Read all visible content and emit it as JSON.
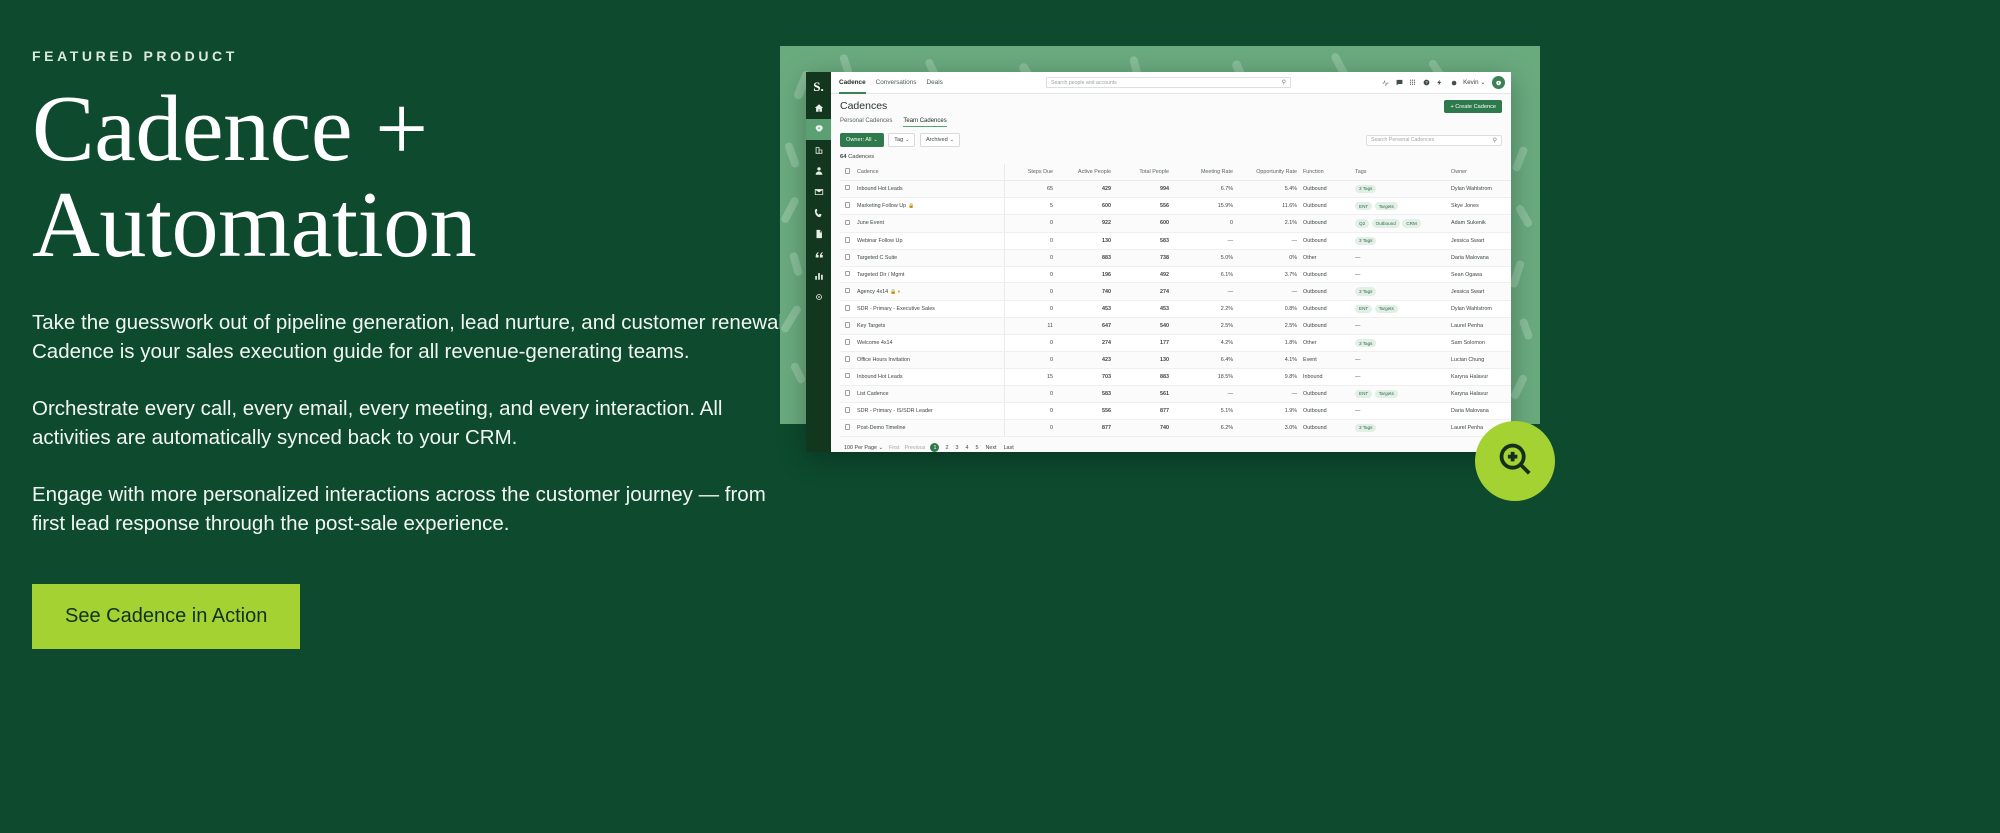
{
  "hero": {
    "eyebrow": "FEATURED PRODUCT",
    "headline": "Cadence +\nAutomation",
    "paragraphs": [
      "Take the guesswork out of pipeline generation, lead nurture, and customer renewals. Cadence is your sales execution guide for all revenue-generating teams.",
      "Orchestrate every call, every email, every meeting, and every interaction. All activities are automatically synced back to your CRM.",
      "Engage with more personalized interactions across the customer journey — from first lead response through the post-sale experience."
    ],
    "cta_label": "See Cadence in Action",
    "colors": {
      "background": "#0d4a2e",
      "cta": "#a4d233",
      "cta_text": "#10321e"
    }
  },
  "screenshot": {
    "rail": {
      "logo": "S.",
      "items": [
        {
          "name": "home-icon",
          "label": "Home"
        },
        {
          "name": "rocket-icon",
          "label": "Cadence"
        },
        {
          "name": "building-icon",
          "label": "Accounts"
        },
        {
          "name": "person-icon",
          "label": "People"
        },
        {
          "name": "envelope-icon",
          "label": "Email"
        },
        {
          "name": "phone-icon",
          "label": "Calls"
        },
        {
          "name": "document-icon",
          "label": "Templates"
        },
        {
          "name": "quote-icon",
          "label": "Snippets"
        },
        {
          "name": "bar-chart-icon",
          "label": "Reports"
        },
        {
          "name": "target-icon",
          "label": "Targets"
        }
      ]
    },
    "topnav": {
      "tabs": [
        {
          "label": "Cadence",
          "selected": true
        },
        {
          "label": "Conversations",
          "selected": false
        },
        {
          "label": "Deals",
          "selected": false
        }
      ],
      "search_placeholder": "Search people and accounts",
      "icons": [
        "activity-icon",
        "chat-icon",
        "dialer-icon",
        "help-icon",
        "lightning-icon",
        "settings-icon"
      ],
      "user_label": "Kevin",
      "avatar_icon": "rocket-icon"
    },
    "page": {
      "title": "Cadences",
      "create_button": "+ Create Cadence",
      "subtabs": [
        {
          "label": "Personal Cadences",
          "selected": false
        },
        {
          "label": "Team Cadences",
          "selected": true
        }
      ],
      "filters": [
        {
          "label": "Owner: All",
          "primary": true
        },
        {
          "label": "Tag",
          "primary": false
        },
        {
          "label": "Archived",
          "primary": false
        }
      ],
      "list_search_placeholder": "Search Personal Cadences",
      "count": "64",
      "count_suffix": " Cadences"
    },
    "table": {
      "columns": [
        "Cadence",
        "Steps Due",
        "Active People",
        "Total People",
        "Meeting Rate",
        "Opportunity Rate",
        "Function",
        "Tags",
        "Owner"
      ],
      "rows": [
        {
          "cadence": "Inbound Hot Leads",
          "lock": false,
          "warn": false,
          "steps_due": "65",
          "active_people": "429",
          "total_people": "994",
          "meeting_rate": "6.7%",
          "opportunity_rate": "5.4%",
          "function": "Outbound",
          "tags": [
            "3 Tags"
          ],
          "owner": "Dylan Wahlstrom"
        },
        {
          "cadence": "Marketing Follow Up",
          "lock": true,
          "warn": false,
          "steps_due": "5",
          "active_people": "600",
          "total_people": "556",
          "meeting_rate": "15.9%",
          "opportunity_rate": "11.6%",
          "function": "Outbound",
          "tags": [
            "ENT",
            "Targets"
          ],
          "owner": "Skye Jones"
        },
        {
          "cadence": "June Event",
          "lock": false,
          "warn": false,
          "steps_due": "0",
          "active_people": "922",
          "total_people": "600",
          "meeting_rate": "0",
          "opportunity_rate": "2.1%",
          "function": "Outbound",
          "tags": [
            "Q2",
            "Outbound",
            "CRM"
          ],
          "owner": "Adam Sukenik"
        },
        {
          "cadence": "Webinar Follow Up",
          "lock": false,
          "warn": false,
          "steps_due": "0",
          "active_people": "130",
          "total_people": "583",
          "meeting_rate": "—",
          "opportunity_rate": "—",
          "function": "Outbound",
          "tags": [
            "3 Tags"
          ],
          "owner": "Jessica Swart"
        },
        {
          "cadence": "Targeted C Suite",
          "lock": false,
          "warn": false,
          "steps_due": "0",
          "active_people": "883",
          "total_people": "738",
          "meeting_rate": "5.0%",
          "opportunity_rate": "0%",
          "function": "Other",
          "tags": [],
          "owner": "Daria Malovana"
        },
        {
          "cadence": "Targeted Dir / Mgmt",
          "lock": false,
          "warn": false,
          "steps_due": "0",
          "active_people": "196",
          "total_people": "492",
          "meeting_rate": "6.1%",
          "opportunity_rate": "3.7%",
          "function": "Outbound",
          "tags": [],
          "owner": "Sean Ogawa"
        },
        {
          "cadence": "Agency 4x14",
          "lock": true,
          "warn": true,
          "steps_due": "0",
          "active_people": "740",
          "total_people": "274",
          "meeting_rate": "—",
          "opportunity_rate": "—",
          "function": "Outbound",
          "tags": [
            "3 Tags"
          ],
          "owner": "Jessica Swart"
        },
        {
          "cadence": "SDR - Primary - Executive Sales",
          "lock": false,
          "warn": false,
          "steps_due": "0",
          "active_people": "453",
          "total_people": "453",
          "meeting_rate": "2.2%",
          "opportunity_rate": "0.8%",
          "function": "Outbound",
          "tags": [
            "ENT",
            "Targets"
          ],
          "owner": "Dylan Wahlstrom"
        },
        {
          "cadence": "Key Targets",
          "lock": false,
          "warn": false,
          "steps_due": "11",
          "active_people": "647",
          "total_people": "540",
          "meeting_rate": "2.5%",
          "opportunity_rate": "2.5%",
          "function": "Outbound",
          "tags": [],
          "owner": "Laurel Penha"
        },
        {
          "cadence": "Welcome 4x14",
          "lock": false,
          "warn": false,
          "steps_due": "0",
          "active_people": "274",
          "total_people": "177",
          "meeting_rate": "4.2%",
          "opportunity_rate": "1.8%",
          "function": "Other",
          "tags": [
            "3 Tags"
          ],
          "owner": "Sam Solomon"
        },
        {
          "cadence": "Office Hours Invitation",
          "lock": false,
          "warn": false,
          "steps_due": "0",
          "active_people": "423",
          "total_people": "130",
          "meeting_rate": "6.4%",
          "opportunity_rate": "4.1%",
          "function": "Event",
          "tags": [],
          "owner": "Lucian Chung"
        },
        {
          "cadence": "Inbound Hot Leads",
          "lock": false,
          "warn": false,
          "steps_due": "15",
          "active_people": "703",
          "total_people": "883",
          "meeting_rate": "18.5%",
          "opportunity_rate": "9.8%",
          "function": "Inbound",
          "tags": [],
          "owner": "Karyna Halavur"
        },
        {
          "cadence": "List Cadence",
          "lock": false,
          "warn": false,
          "steps_due": "0",
          "active_people": "583",
          "total_people": "561",
          "meeting_rate": "—",
          "opportunity_rate": "—",
          "function": "Outbound",
          "tags": [
            "ENT",
            "Targets"
          ],
          "owner": "Karyna Halavur"
        },
        {
          "cadence": "SDR - Primary - IS/SDR Leader",
          "lock": false,
          "warn": false,
          "steps_due": "0",
          "active_people": "556",
          "total_people": "877",
          "meeting_rate": "5.1%",
          "opportunity_rate": "1.9%",
          "function": "Outbound",
          "tags": [],
          "owner": "Daria Malovana"
        },
        {
          "cadence": "Post-Demo Timeline",
          "lock": false,
          "warn": false,
          "steps_due": "0",
          "active_people": "877",
          "total_people": "740",
          "meeting_rate": "6.2%",
          "opportunity_rate": "3.0%",
          "function": "Outbound",
          "tags": [
            "3 Tags"
          ],
          "owner": "Laurel Penha"
        }
      ]
    },
    "pagination": {
      "per_page": "100 Per Page",
      "first": "First",
      "previous": "Previous",
      "pages": [
        "1",
        "2",
        "3",
        "4",
        "5"
      ],
      "current_page": "1",
      "next": "Next",
      "last": "Last"
    }
  },
  "zoom_badge": {
    "icon": "magnifier-plus-icon"
  }
}
